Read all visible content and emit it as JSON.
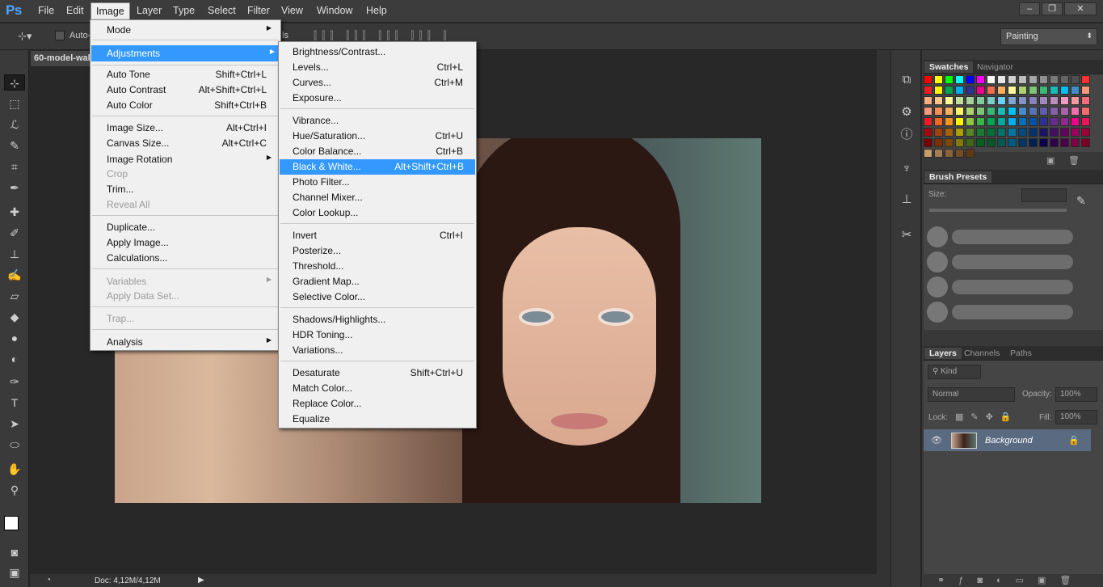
{
  "app": {
    "logo": "Ps"
  },
  "menubar": {
    "items": [
      "File",
      "Edit",
      "Image",
      "Layer",
      "Type",
      "Select",
      "Filter",
      "View",
      "Window",
      "Help"
    ],
    "active": "Image"
  },
  "options": {
    "auto_select_label": "Auto-",
    "partial_text": "ls",
    "workspace": "Painting"
  },
  "document": {
    "tab_title": "60-model-wal",
    "status": "Doc: 4,12M/4,12M"
  },
  "image_menu": {
    "mode": "Mode",
    "adjustments": "Adjustments",
    "auto_tone": "Auto Tone",
    "auto_tone_key": "Shift+Ctrl+L",
    "auto_contrast": "Auto Contrast",
    "auto_contrast_key": "Alt+Shift+Ctrl+L",
    "auto_color": "Auto Color",
    "auto_color_key": "Shift+Ctrl+B",
    "image_size": "Image Size...",
    "image_size_key": "Alt+Ctrl+I",
    "canvas_size": "Canvas Size...",
    "canvas_size_key": "Alt+Ctrl+C",
    "image_rotation": "Image Rotation",
    "crop": "Crop",
    "trim": "Trim...",
    "reveal_all": "Reveal All",
    "duplicate": "Duplicate...",
    "apply_image": "Apply Image...",
    "calculations": "Calculations...",
    "variables": "Variables",
    "apply_data_set": "Apply Data Set...",
    "trap": "Trap...",
    "analysis": "Analysis"
  },
  "adjustments_menu": {
    "brightness_contrast": "Brightness/Contrast...",
    "levels": "Levels...",
    "levels_key": "Ctrl+L",
    "curves": "Curves...",
    "curves_key": "Ctrl+M",
    "exposure": "Exposure...",
    "vibrance": "Vibrance...",
    "hue_saturation": "Hue/Saturation...",
    "hue_saturation_key": "Ctrl+U",
    "color_balance": "Color Balance...",
    "color_balance_key": "Ctrl+B",
    "black_white": "Black & White...",
    "black_white_key": "Alt+Shift+Ctrl+B",
    "photo_filter": "Photo Filter...",
    "channel_mixer": "Channel Mixer...",
    "color_lookup": "Color Lookup...",
    "invert": "Invert",
    "invert_key": "Ctrl+I",
    "posterize": "Posterize...",
    "threshold": "Threshold...",
    "gradient_map": "Gradient Map...",
    "selective_color": "Selective Color...",
    "shadows_highlights": "Shadows/Highlights...",
    "hdr_toning": "HDR Toning...",
    "variations": "Variations...",
    "desaturate": "Desaturate",
    "desaturate_key": "Shift+Ctrl+U",
    "match_color": "Match Color...",
    "replace_color": "Replace Color...",
    "equalize": "Equalize"
  },
  "panels": {
    "swatches_tab": "Swatches",
    "navigator_tab": "Navigator",
    "brush_presets_tab": "Brush Presets",
    "size_label": "Size:",
    "layers_tab": "Layers",
    "channels_tab": "Channels",
    "paths_tab": "Paths",
    "kind_label": "Kind",
    "blend_mode": "Normal",
    "opacity_label": "Opacity:",
    "opacity_value": "100%",
    "lock_label": "Lock:",
    "fill_label": "Fill:",
    "fill_value": "100%",
    "layer_name": "Background"
  },
  "colors": {
    "accent": "#3399ff",
    "menu_bg": "#f0f0f0",
    "ui_dark": "#383838"
  }
}
